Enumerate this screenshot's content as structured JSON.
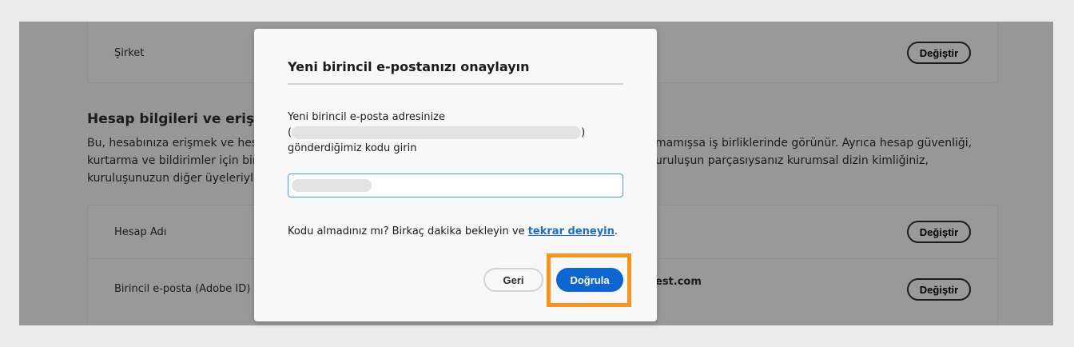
{
  "background": {
    "company_row": {
      "label": "Şirket",
      "button": "Değiştir"
    },
    "section": {
      "title_visible": "Hesap bilgileri ve erişir",
      "paragraph_left": [
        "Bu, hesabınıza erişmek ve hesa",
        "kurtarma ve bildirimler için bir",
        "kuruluşunuzun diğer üyeleriyle"
      ],
      "paragraph_right": [
        "mamışsa iş birliklerinde görünür. Ayrıca hesap güvenliği,",
        "uruluşun parçasıysanız kurumsal dizin kimliğiniz,"
      ]
    },
    "rows": [
      {
        "label": "Hesap Adı",
        "value": "",
        "button": "Değiştir"
      },
      {
        "label": "Birincil e-posta (Adobe ID)",
        "value": "est.com",
        "button": "Değiştir"
      }
    ]
  },
  "dialog": {
    "title": "Yeni birincil e-postanızı onaylayın",
    "instruction_line1": "Yeni birincil e-posta adresinize",
    "open_paren": "(",
    "close_paren": ")",
    "instruction_line3": "gönderdiğimiz kodu girin",
    "code_input_value": "",
    "resend_text": "Kodu almadınız mı? Birkaç dakika bekleyin ve ",
    "resend_link": "tekrar deneyin",
    "resend_end": ".",
    "back_button": "Geri",
    "verify_button": "Doğrula",
    "colors": {
      "accent": "#0d66d0",
      "highlight": "#f7931e"
    }
  }
}
